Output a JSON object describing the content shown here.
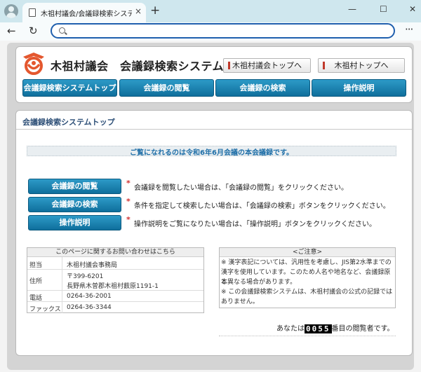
{
  "browser": {
    "tab_title": "木祖村議会/会議録検索システム",
    "tab_close": "×",
    "new_tab": "+",
    "minimize": "—",
    "maximize": "☐",
    "close": "✕",
    "back": "←",
    "reload": "↻",
    "more": "···",
    "address": ""
  },
  "site": {
    "title": "木祖村議会　会議録検索システム",
    "link_gikai": "木祖村議会トップへ",
    "link_village": "木祖村トップへ",
    "nav": [
      "会議録検索システムトップ",
      "会議録の閲覧",
      "会議録の検索",
      "操作説明"
    ]
  },
  "main": {
    "section_title": "会議録検索システムトップ",
    "notice": "ご覧になれるのは令和6年6月会議の本会議録です。",
    "actions": [
      {
        "label": "会議録の閲覧",
        "mark": "*",
        "desc": "会議録を閲覧したい場合は、「会議録の閲覧」をクリックください。"
      },
      {
        "label": "会議録の検索",
        "mark": "*",
        "desc": "条件を指定して検索したい場合は、「会議録の検索」ボタンをクリックください。"
      },
      {
        "label": "操作説明",
        "mark": "*",
        "desc": "操作説明をご覧になりたい場合は、「操作説明」ボタンをクリックください。"
      }
    ]
  },
  "contact": {
    "header": "このページに関するお問い合わせはこちら",
    "rows": [
      {
        "label": "担当",
        "value": "木祖村議会事務局"
      },
      {
        "label": "住所",
        "value": "〒399-6201",
        "value2": "長野県木曽郡木祖村薮原1191-1"
      },
      {
        "label": "電話",
        "value": "0264-36-2001"
      },
      {
        "label": "ファックス",
        "value": "0264-36-3344"
      }
    ]
  },
  "caution": {
    "header": "<ご注意>",
    "lines": [
      "※ 漢字表記については、汎用性を考慮し、JIS第2水準までの",
      "漢字を使用しています。このため人名や地名など、会議録原本",
      "と異なる場合があります。",
      "※ この会議録検索システムは、木祖村議会の公式の記録では",
      "ありません。"
    ]
  },
  "counter": {
    "prefix": "あなたは",
    "digits": "0055",
    "suffix": "番目の閲覧者です。"
  },
  "colors": {
    "button_blue": "#1a84b3",
    "notice_text": "#1f6fa8",
    "logo_orange": "#e4572e",
    "address_focus": "#1f5fae"
  }
}
